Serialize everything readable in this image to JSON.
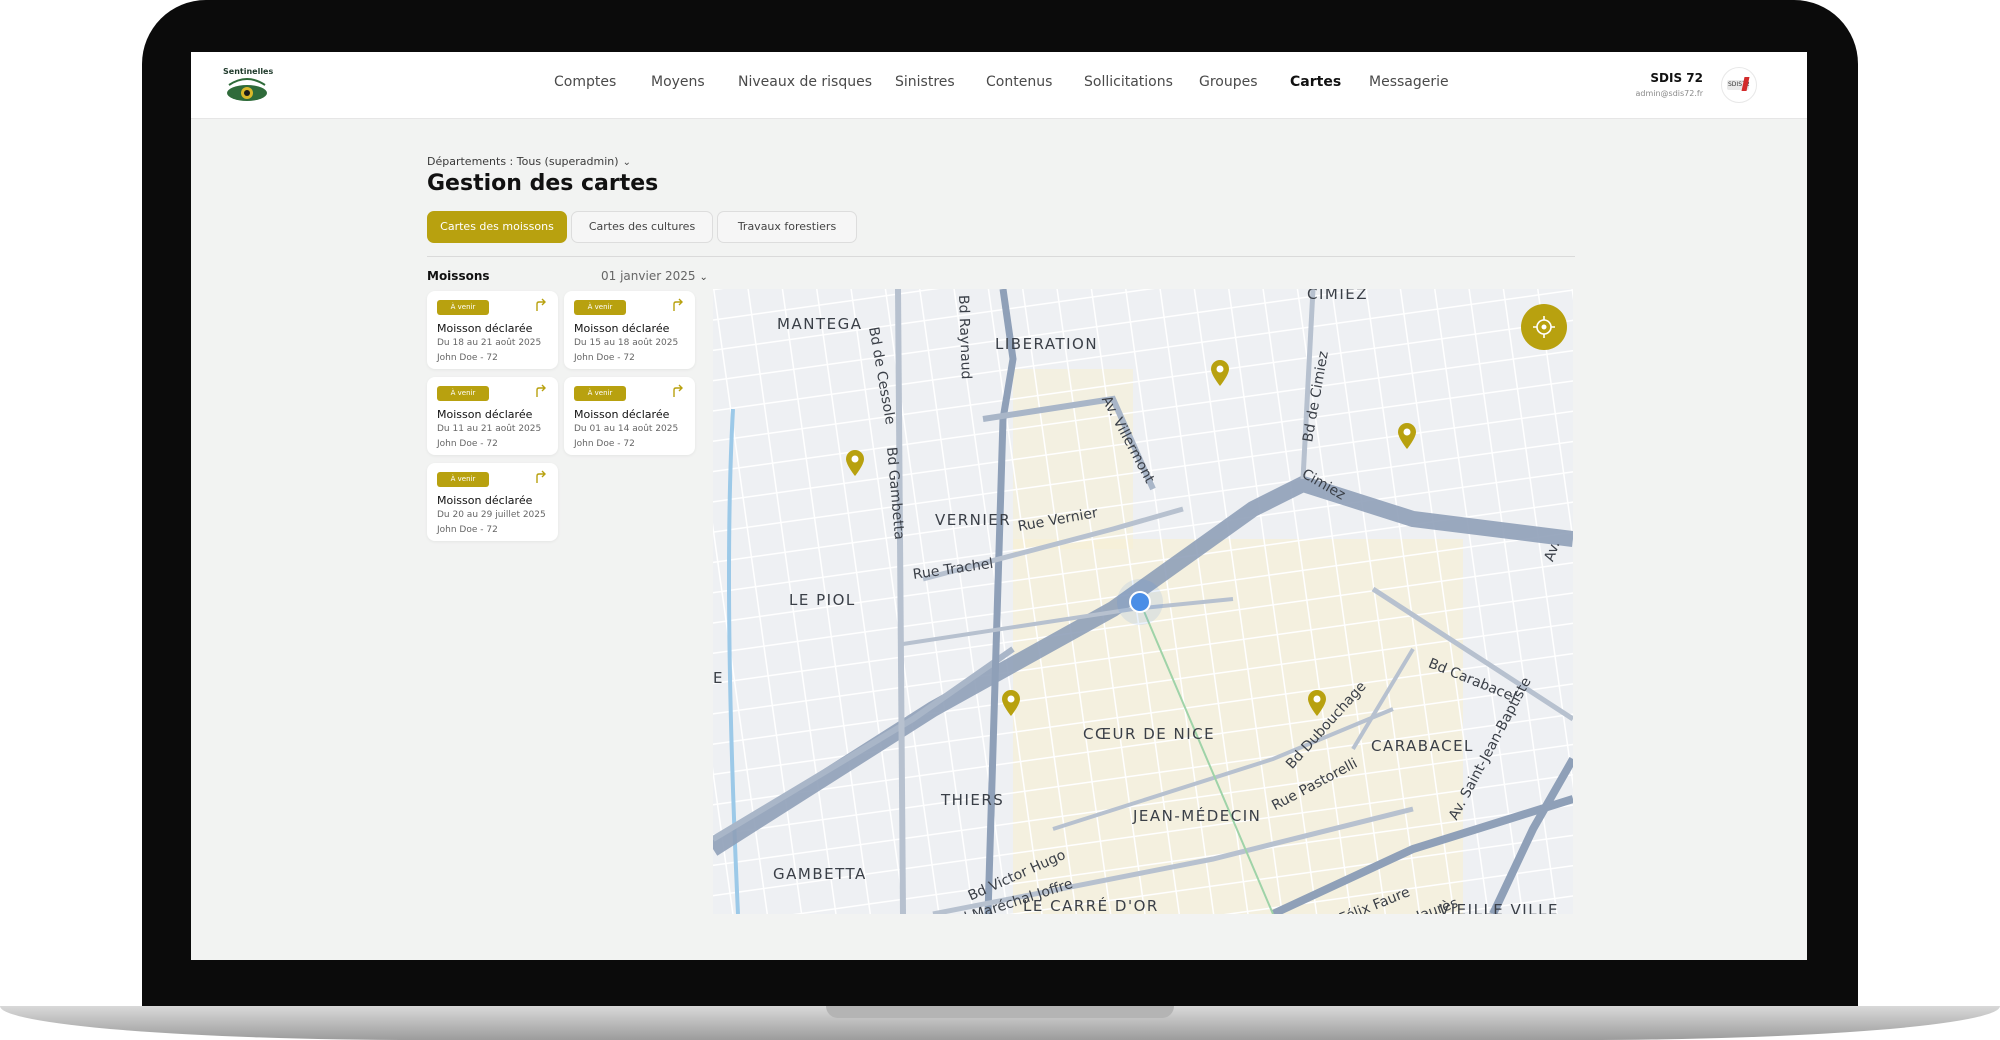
{
  "app": {
    "logo_text": "Sentinelles",
    "nav": [
      "Comptes",
      "Moyens",
      "Niveaux de risques",
      "Sinistres",
      "Contenus",
      "Sollicitations",
      "Groupes",
      "Cartes",
      "Messagerie"
    ],
    "active_nav": "Cartes",
    "user": {
      "name": "SDIS 72",
      "email": "admin@sdis72.fr",
      "avatar_text": "SDIS72"
    }
  },
  "page": {
    "department_filter": "Départements : Tous (superadmin)",
    "title": "Gestion des cartes",
    "tabs": [
      "Cartes des moissons",
      "Cartes des cultures",
      "Travaux forestiers"
    ],
    "active_tab": "Cartes des moissons"
  },
  "list": {
    "title": "Moissons",
    "date": "01 janvier 2025",
    "cards": [
      {
        "badge": "À venir",
        "title": "Moisson déclarée",
        "dates": "Du 18 au 21 août 2025",
        "author": "John Doe - 72"
      },
      {
        "badge": "À venir",
        "title": "Moisson déclarée",
        "dates": "Du 15 au 18 août 2025",
        "author": "John Doe - 72"
      },
      {
        "badge": "À venir",
        "title": "Moisson déclarée",
        "dates": "Du 11 au 21 août 2025",
        "author": "John Doe - 72"
      },
      {
        "badge": "À venir",
        "title": "Moisson déclarée",
        "dates": "Du 01 au 14 août 2025",
        "author": "John Doe - 72"
      },
      {
        "badge": "À venir",
        "title": "Moisson déclarée",
        "dates": "Du 20 au 29 juillet 2025",
        "author": "John Doe - 72"
      }
    ]
  },
  "map": {
    "districts": [
      "MANTEGA",
      "LIBERATION",
      "VERNIER",
      "LE PIOL",
      "CŒUR DE NICE",
      "CARABACEL",
      "THIERS",
      "JEAN-MÉDECIN",
      "GAMBETTA",
      "LE CARRÉ D'OR",
      "VIEILLE VILLE",
      "CIMIEZ",
      "E"
    ],
    "streets": [
      "Bd de Cessole",
      "Bd Gambetta",
      "Av. Villermont",
      "Rue Vernier",
      "Rue Trachel",
      "Bd de Cimiez",
      "Bd Carabacel",
      "Bd Dubouchage",
      "Rue Pastorelli",
      "Av. Saint-Jean-Baptiste",
      "Bd Victor Hugo",
      "Bd Maréchal Joffre",
      "Av. Félix Faure",
      "Bd Jean Jaurès",
      "Bd Raynaud",
      "Cimiez",
      "Av."
    ]
  },
  "colors": {
    "accent": "#b8a10f",
    "location": "#4a8ee6",
    "road_major": "#8fa0b8"
  },
  "icons": {
    "locate": "crosshair-icon",
    "card_action": "share-arrow-icon",
    "pin": "map-pin-icon",
    "dropdown": "chevron-down-icon"
  }
}
